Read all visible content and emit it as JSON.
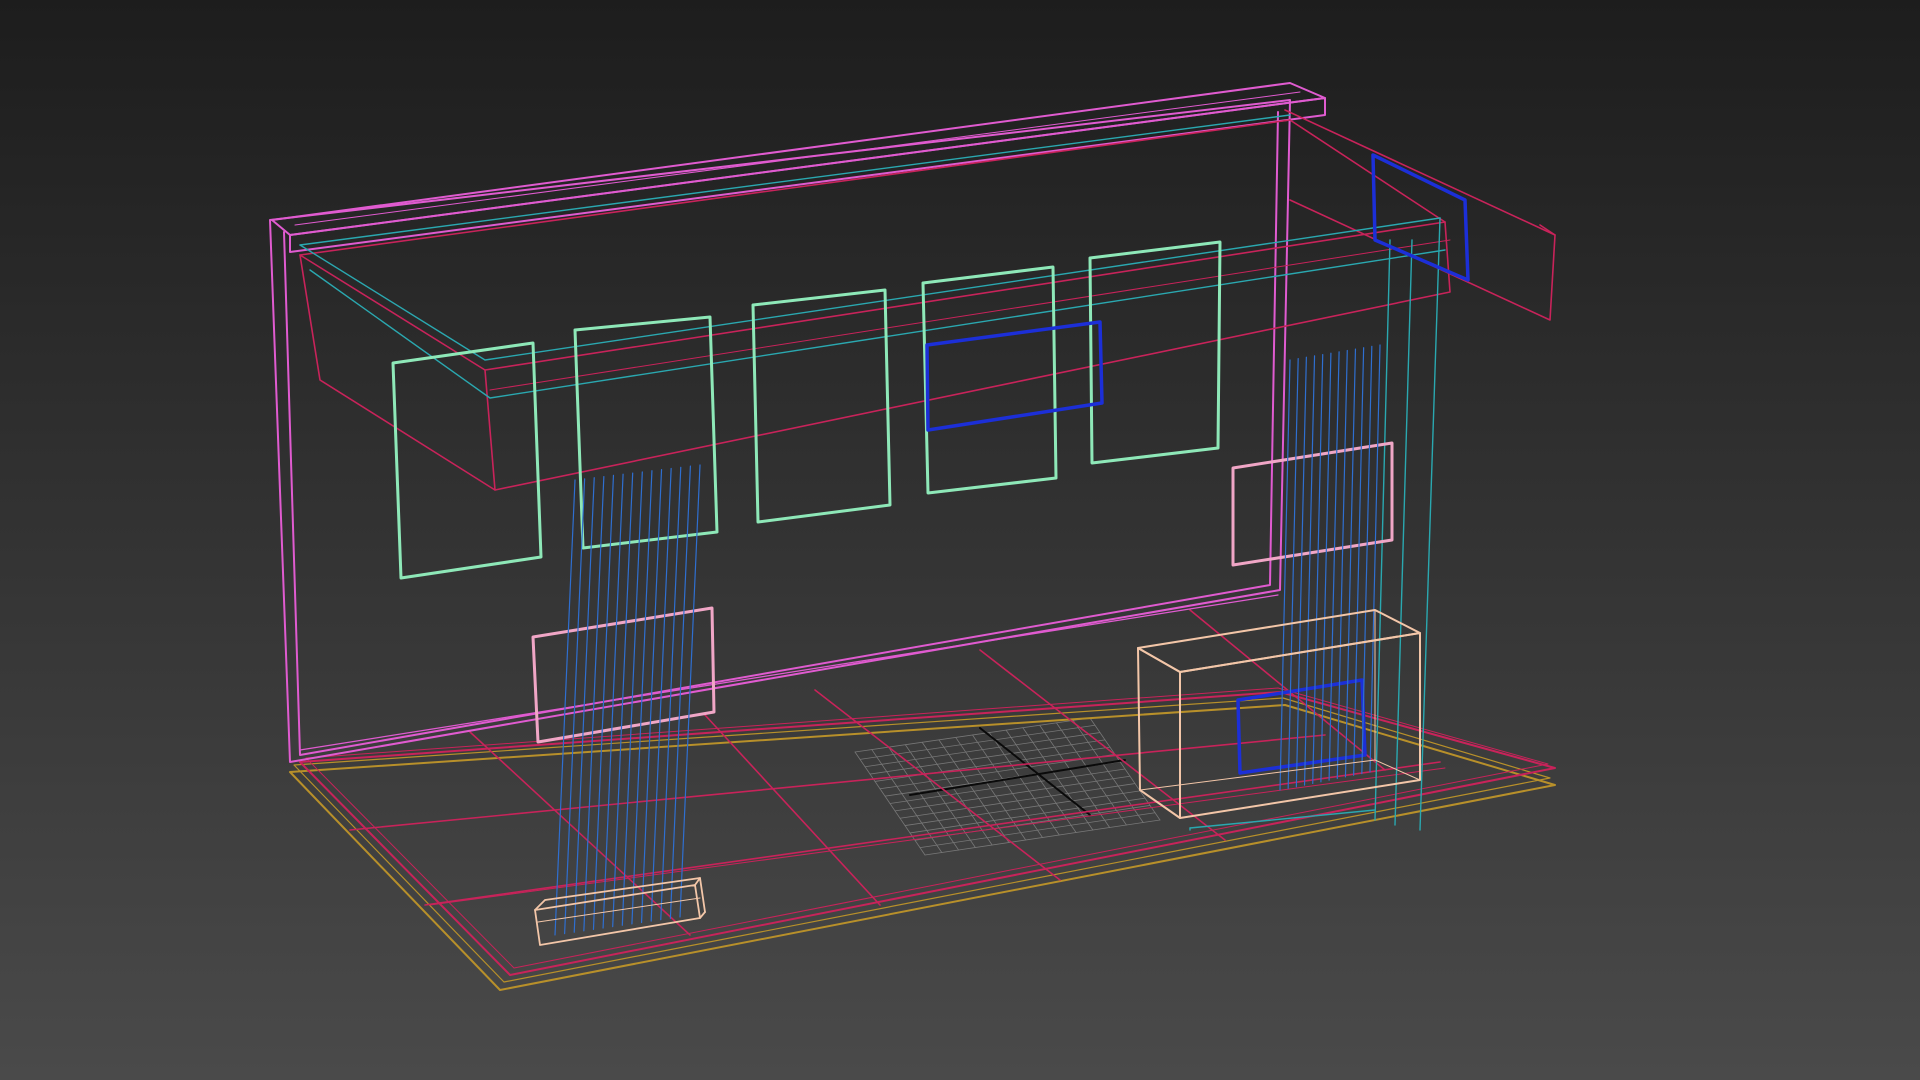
{
  "viewport": {
    "label": "",
    "render_mode": "wireframe"
  },
  "colors": {
    "background_top": "#1d1d1d",
    "background_bottom": "#4a4a4a",
    "wall_frame": "#e05bd0",
    "floor_frame": "#c8235a",
    "floor_edge": "#b8902a",
    "cyan_frame": "#2aa8b0",
    "panel": "#8ee8b8",
    "pink_panel": "#f0a6c6",
    "blue_highlight": "#1c2fd8",
    "cable": "#2f6fd0",
    "box": "#f3c6a8",
    "grid": "#8a8a8a",
    "grid_axis": "#0a0a0a"
  },
  "objects": [
    "back-wall",
    "top-beam",
    "floor-slab",
    "display-panels",
    "pink-panels",
    "cable-bundles",
    "base-box",
    "cabinet-box",
    "home-grid"
  ]
}
